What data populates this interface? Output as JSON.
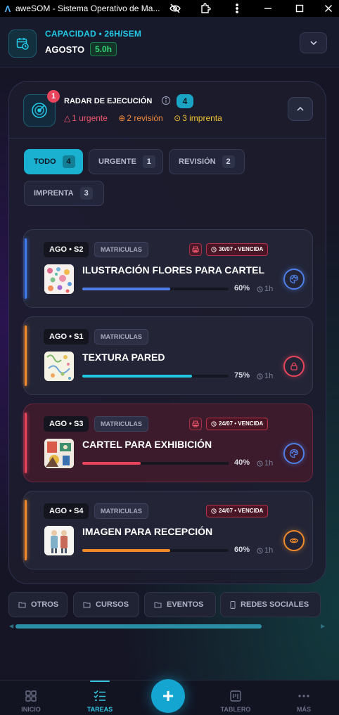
{
  "window": {
    "title": "aweSOM - Sistema Operativo de Ma...",
    "logo_glyph": "Ʌ"
  },
  "header": {
    "capacity_label": "CAPACIDAD • 26H/SEM",
    "month": "AGOSTO",
    "hours_badge": "5.0h"
  },
  "radar": {
    "title": "RADAR DE EJECUCIÓN",
    "alert_count": "1",
    "total_count": "4",
    "summary": {
      "urgent": "1 urgente",
      "review": "2 revisión",
      "print": "3 imprenta"
    },
    "filters": [
      {
        "label": "TODO",
        "count": "4",
        "active": true
      },
      {
        "label": "URGENTE",
        "count": "1",
        "active": false
      },
      {
        "label": "REVISIÓN",
        "count": "2",
        "active": false
      },
      {
        "label": "IMPRENTA",
        "count": "3",
        "active": false
      }
    ],
    "cards": [
      {
        "period": "AGO • S2",
        "category": "MATRICULAS",
        "print_flag": true,
        "overdue": "30/07 • VENCIDA",
        "title": "ILUSTRACIÓN FLORES PARA CARTEL",
        "progress": 0.6,
        "progress_label": "60%",
        "hours": "1h",
        "accent": "#3f7cf0",
        "bar_color": "#4f7fe6",
        "status_icon": "palette-icon",
        "status_color": "#4f7fe6"
      },
      {
        "period": "AGO • S1",
        "category": "MATRICULAS",
        "print_flag": false,
        "overdue": "",
        "title": "TEXTURA PARED",
        "progress": 0.75,
        "progress_label": "75%",
        "hours": "1h",
        "accent": "#f08a2a",
        "bar_color": "#22c6e0",
        "status_icon": "lock-icon",
        "status_color": "#e8455d"
      },
      {
        "period": "AGO • S3",
        "category": "MATRICULAS",
        "print_flag": true,
        "overdue": "24/07 • VENCIDA",
        "title": "CARTEL PARA EXHIBICIÓN",
        "progress": 0.4,
        "progress_label": "40%",
        "hours": "1h",
        "accent": "#e8455d",
        "bar_color": "#e8455d",
        "status_icon": "palette-icon",
        "status_color": "#4f7fe6"
      },
      {
        "period": "AGO • S4",
        "category": "MATRICULAS",
        "print_flag": false,
        "overdue": "24/07 • VENCIDA",
        "title": "IMAGEN PARA RECEPCIÓN",
        "progress": 0.6,
        "progress_label": "60%",
        "hours": "1h",
        "accent": "#f08a2a",
        "bar_color": "#f0882a",
        "status_icon": "eye-icon",
        "status_color": "#f08a2a"
      }
    ]
  },
  "categories": [
    {
      "label": "OTROS",
      "icon": "folder-icon"
    },
    {
      "label": "CURSOS",
      "icon": "folder-icon"
    },
    {
      "label": "EVENTOS",
      "icon": "folder-icon"
    },
    {
      "label": "REDES SOCIALES",
      "icon": "phone-icon"
    }
  ],
  "nav": {
    "items": [
      {
        "label": "INICIO",
        "icon": "grid-icon"
      },
      {
        "label": "TAREAS",
        "icon": "checklist-icon",
        "active": true
      },
      {
        "label": "TABLERO",
        "icon": "board-icon"
      },
      {
        "label": "MÁS",
        "icon": "more-icon"
      }
    ],
    "fab": "+"
  }
}
